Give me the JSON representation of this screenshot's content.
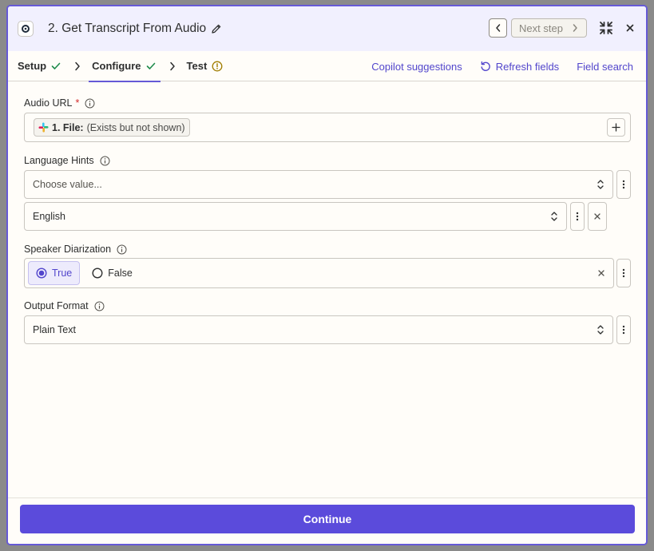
{
  "header": {
    "title": "2. Get Transcript From Audio",
    "next_step_label": "Next step"
  },
  "tabs": [
    {
      "label": "Setup",
      "status": "complete"
    },
    {
      "label": "Configure",
      "status": "complete"
    },
    {
      "label": "Test",
      "status": "warning"
    }
  ],
  "tab_links": {
    "copilot": "Copilot suggestions",
    "refresh": "Refresh fields",
    "search": "Field search"
  },
  "fields": {
    "audio_url": {
      "label": "Audio URL",
      "required_mark": "*",
      "chip_source": "1. File:",
      "chip_value": "(Exists but not shown)"
    },
    "language_hints": {
      "label": "Language Hints",
      "placeholder": "Choose value...",
      "values": [
        "English"
      ]
    },
    "speaker_diarization": {
      "label": "Speaker Diarization",
      "options": [
        "True",
        "False"
      ],
      "selected": "True"
    },
    "output_format": {
      "label": "Output Format",
      "value": "Plain Text"
    }
  },
  "footer": {
    "continue_label": "Continue"
  },
  "colors": {
    "accent": "#5b4bdb",
    "link": "#5246cc",
    "success": "#1f8b4c",
    "warning": "#a07d00",
    "required": "#d42a2a"
  }
}
